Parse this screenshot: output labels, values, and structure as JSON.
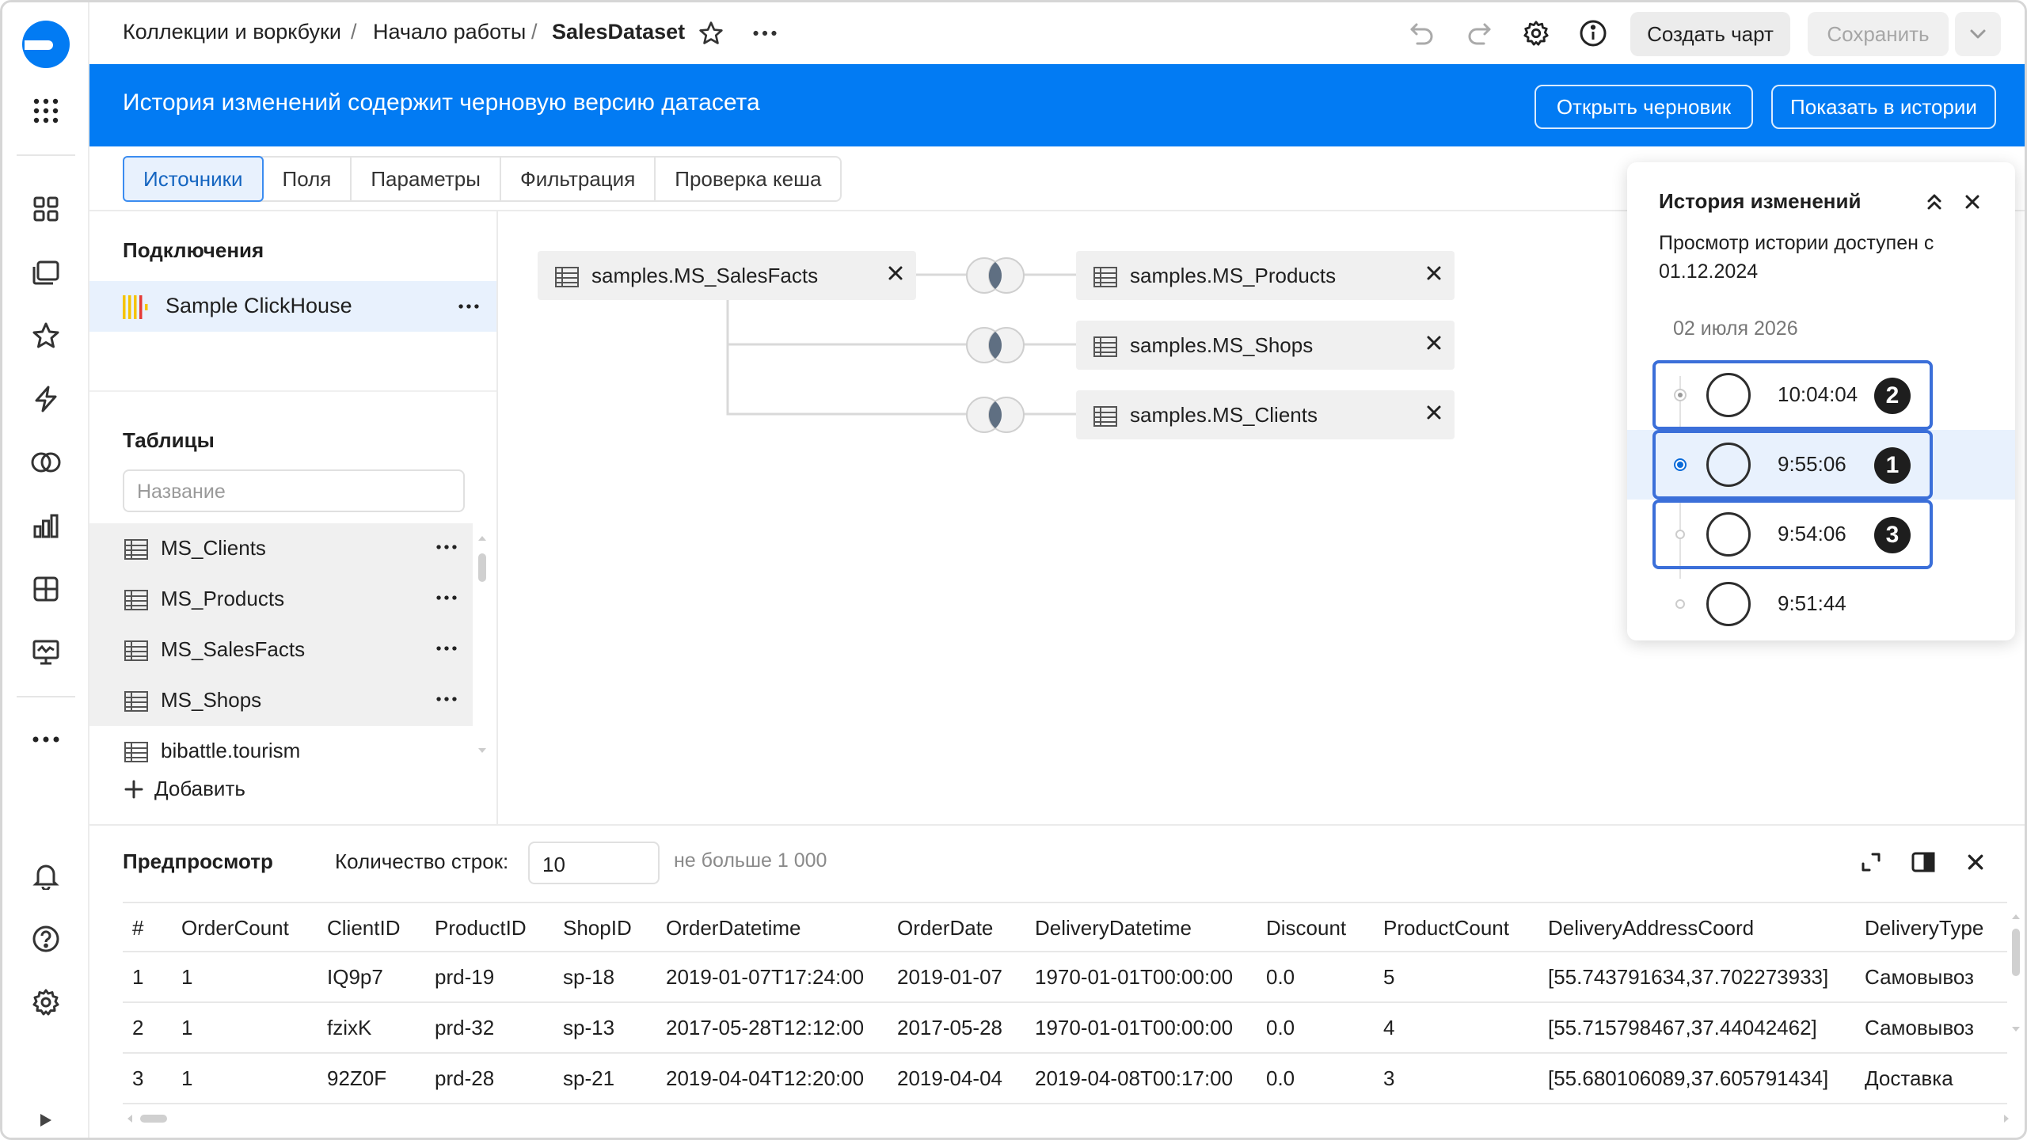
{
  "breadcrumb": {
    "items": [
      "Коллекции и воркбуки",
      "Начало работы",
      "SalesDataset"
    ],
    "separator": "/"
  },
  "toolbar": {
    "create_chart": "Создать чарт",
    "save": "Сохранить"
  },
  "banner": {
    "text": "История изменений содержит черновую версию датасета",
    "open_draft": "Открыть черновик",
    "show_in_history": "Показать в истории"
  },
  "tabs": [
    "Источники",
    "Поля",
    "Параметры",
    "Фильтрация",
    "Проверка кеша"
  ],
  "left_panel": {
    "connections_title": "Подключения",
    "connection": "Sample ClickHouse",
    "tables_title": "Таблицы",
    "search_placeholder": "Название",
    "tables": [
      "MS_Clients",
      "MS_Products",
      "MS_SalesFacts",
      "MS_Shops",
      "bibattle.tourism"
    ],
    "add_label": "Добавить"
  },
  "canvas": {
    "root": "samples.MS_SalesFacts",
    "joined": [
      "samples.MS_Products",
      "samples.MS_Shops",
      "samples.MS_Clients"
    ]
  },
  "history": {
    "title": "История изменений",
    "subtitle": "Просмотр истории доступен с 01.12.2024",
    "date": "02 июля 2026",
    "versions": [
      {
        "time": "10:04:04",
        "badge": "2"
      },
      {
        "time": "9:55:06",
        "badge": "1"
      },
      {
        "time": "9:54:06",
        "badge": "3"
      },
      {
        "time": "9:51:44",
        "badge": ""
      }
    ]
  },
  "preview": {
    "title": "Предпросмотр",
    "rows_label": "Количество строк:",
    "rows_value": "10",
    "rows_hint": "не больше 1 000",
    "columns": [
      "#",
      "OrderCount",
      "ClientID",
      "ProductID",
      "ShopID",
      "OrderDatetime",
      "OrderDate",
      "DeliveryDatetime",
      "Discount",
      "ProductCount",
      "DeliveryAddressCoord",
      "DeliveryType"
    ],
    "rows": [
      [
        "1",
        "1",
        "IQ9p7",
        "prd-19",
        "sp-18",
        "2019-01-07T17:24:00",
        "2019-01-07",
        "1970-01-01T00:00:00",
        "0.0",
        "5",
        "[55.743791634,37.702273933]",
        "Самовывоз"
      ],
      [
        "2",
        "1",
        "fzixK",
        "prd-32",
        "sp-13",
        "2017-05-28T12:12:00",
        "2017-05-28",
        "1970-01-01T00:00:00",
        "0.0",
        "4",
        "[55.715798467,37.44042462]",
        "Самовывоз"
      ],
      [
        "3",
        "1",
        "92Z0F",
        "prd-28",
        "sp-21",
        "2019-04-04T12:20:00",
        "2019-04-04",
        "2019-04-08T00:17:00",
        "0.0",
        "3",
        "[55.680106089,37.605791434]",
        "Доставка"
      ]
    ]
  },
  "colors": {
    "accent": "#027bf3",
    "selection": "#e8f1fd",
    "highlight_box": "#3b6fd9"
  }
}
